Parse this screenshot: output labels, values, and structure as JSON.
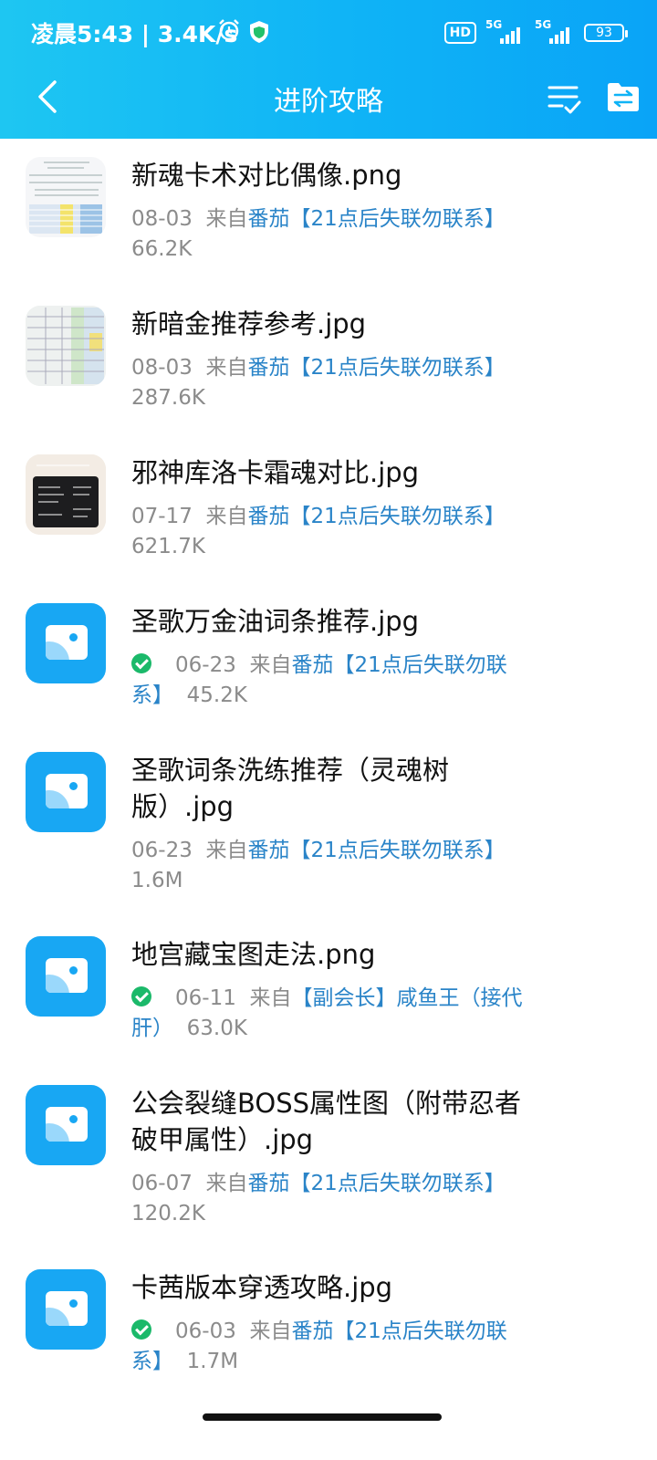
{
  "status_bar": {
    "time": "凌晨5:43 | 3.4K/s",
    "hd": "HD",
    "net1": "5G",
    "net2": "5G",
    "battery": "93"
  },
  "nav": {
    "title": "进阶攻略"
  },
  "colors": {
    "header_start": "#1ec6f2",
    "header_end": "#0aa4f7",
    "link": "#2a84c8",
    "check": "#1bb96a",
    "icon_blue": "#18a7f3"
  },
  "files": [
    {
      "name": "新魂卡术对比偶像.png",
      "date": "08-03",
      "from": "来自",
      "source": "番茄【21点后失联勿联系】",
      "size": "66.2K",
      "thumb": "preview"
    },
    {
      "name": "新暗金推荐参考.jpg",
      "date": "08-03",
      "from": "来自",
      "source": "番茄【21点后失联勿联系】",
      "size": "287.6K",
      "thumb": "preview"
    },
    {
      "name": "邪神库洛卡霜魂对比.jpg",
      "date": "07-17",
      "from": "来自",
      "source": "番茄【21点后失联勿联系】",
      "size": "621.7K",
      "thumb": "preview"
    },
    {
      "name": "圣歌万金油词条推荐.jpg",
      "date": "06-23",
      "from": "来自",
      "source_line1": "番茄【21点后失联勿联",
      "source_line2": "系】",
      "size": "45.2K",
      "thumb": "image-icon",
      "downloaded": true
    },
    {
      "name_line1": "圣歌词条洗练推荐（灵魂树",
      "name_line2": "版）.jpg",
      "date": "06-23",
      "from": "来自",
      "source": "番茄【21点后失联勿联系】",
      "size": "1.6M",
      "thumb": "image-icon"
    },
    {
      "name": "地宫藏宝图走法.png",
      "date": "06-11",
      "from": "来自",
      "source_line1": "【副会长】咸鱼王（接代",
      "source_line2": "肝）",
      "size": "63.0K",
      "thumb": "image-icon",
      "downloaded": true
    },
    {
      "name_line1": "公会裂缝BOSS属性图（附带忍者",
      "name_line2": "破甲属性）.jpg",
      "date": "06-07",
      "from": "来自",
      "source": "番茄【21点后失联勿联系】",
      "size": "120.2K",
      "thumb": "image-icon"
    },
    {
      "name": "卡茜版本穿透攻略.jpg",
      "date": "06-03",
      "from": "来自",
      "source_line1": "番茄【21点后失联勿联",
      "source_line2": "系】",
      "size": "1.7M",
      "thumb": "image-icon",
      "downloaded": true
    }
  ]
}
